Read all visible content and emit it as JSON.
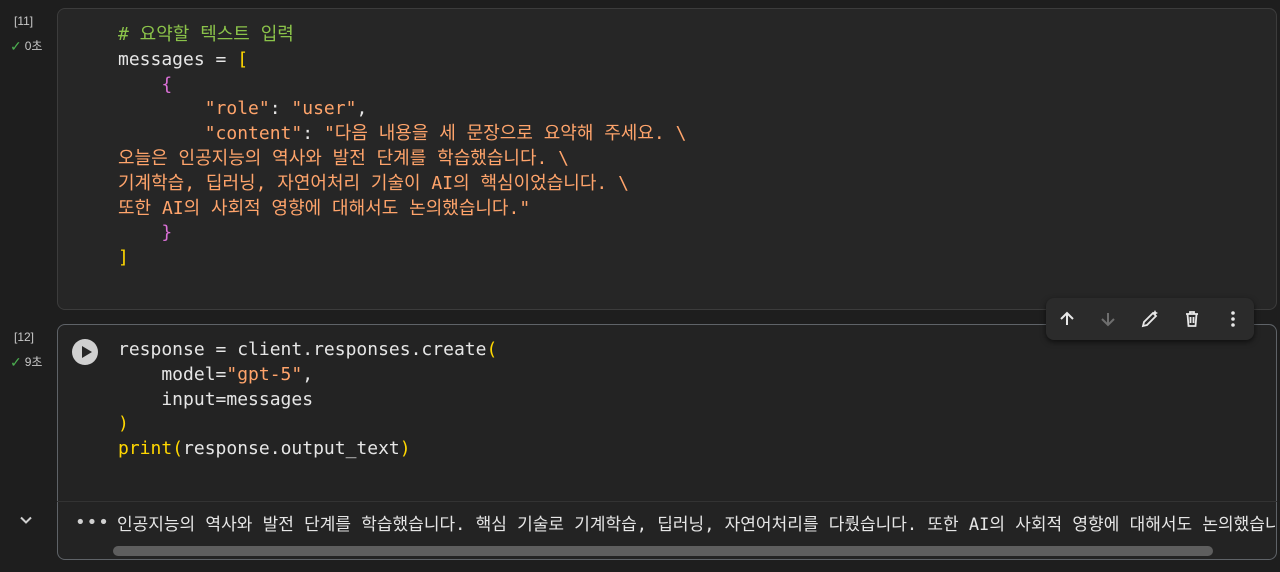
{
  "cells": [
    {
      "exec_count": "[11]",
      "status": "0초",
      "lines": [
        [
          {
            "t": "# 요약할 텍스트 입력",
            "c": "comment"
          }
        ],
        [
          {
            "t": "messages = ",
            "c": "plain"
          },
          {
            "t": "[",
            "c": "bracket-y"
          }
        ],
        [
          {
            "t": "    ",
            "c": "plain"
          },
          {
            "t": "{",
            "c": "bracket-p"
          }
        ],
        [
          {
            "t": "        ",
            "c": "plain"
          },
          {
            "t": "\"role\"",
            "c": "str"
          },
          {
            "t": ": ",
            "c": "plain"
          },
          {
            "t": "\"user\"",
            "c": "str"
          },
          {
            "t": ",",
            "c": "plain"
          }
        ],
        [
          {
            "t": "        ",
            "c": "plain"
          },
          {
            "t": "\"content\"",
            "c": "str"
          },
          {
            "t": ": ",
            "c": "plain"
          },
          {
            "t": "\"다음 내용을 세 문장으로 요약해 주세요. \\",
            "c": "str"
          }
        ],
        [
          {
            "t": "오늘은 인공지능의 역사와 발전 단계를 학습했습니다. \\",
            "c": "str"
          }
        ],
        [
          {
            "t": "기계학습, 딥러닝, 자연어처리 기술이 AI의 핵심이었습니다. \\",
            "c": "str"
          }
        ],
        [
          {
            "t": "또한 AI의 사회적 영향에 대해서도 논의했습니다.\"",
            "c": "str"
          }
        ],
        [
          {
            "t": "    ",
            "c": "plain"
          },
          {
            "t": "}",
            "c": "bracket-p"
          }
        ],
        [
          {
            "t": "]",
            "c": "bracket-y"
          }
        ]
      ]
    },
    {
      "exec_count": "[12]",
      "status": "9초",
      "lines": [
        [
          {
            "t": "response = client.responses.create",
            "c": "plain"
          },
          {
            "t": "(",
            "c": "bracket-y"
          }
        ],
        [
          {
            "t": "    model=",
            "c": "plain"
          },
          {
            "t": "\"gpt-5\"",
            "c": "str"
          },
          {
            "t": ",",
            "c": "plain"
          }
        ],
        [
          {
            "t": "    input=messages",
            "c": "plain"
          }
        ],
        [
          {
            "t": ")",
            "c": "bracket-y"
          }
        ],
        [
          {
            "t": "print",
            "c": "bracket-y"
          },
          {
            "t": "(",
            "c": "bracket-y"
          },
          {
            "t": "response.output_text",
            "c": "plain"
          },
          {
            "t": ")",
            "c": "bracket-y"
          }
        ]
      ],
      "output": "인공지능의 역사와 발전 단계를 학습했습니다. 핵심 기술로 기계학습, 딥러닝, 자연어처리를 다뤘습니다. 또한 AI의 사회적 영향에 대해서도 논의했습니다."
    }
  ],
  "toolbar": {
    "buttons": [
      "move-up-icon",
      "move-down-icon",
      "edit-icon",
      "delete-icon",
      "more-vert-icon"
    ]
  },
  "colors": {
    "comment": "#8bc34a",
    "string": "#ffa46b",
    "bracket_yellow": "#ffd700",
    "bracket_purple": "#da70d6",
    "check": "#4caf50"
  }
}
